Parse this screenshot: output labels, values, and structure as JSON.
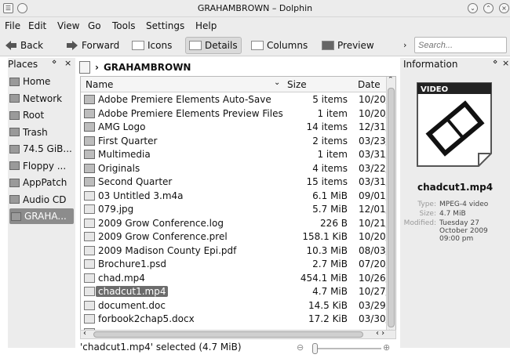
{
  "window": {
    "title": "GRAHAMBROWN – Dolphin"
  },
  "menu": [
    "File",
    "Edit",
    "View",
    "Go",
    "Tools",
    "Settings",
    "Help"
  ],
  "toolbar": {
    "back": "Back",
    "forward": "Forward",
    "icons": "Icons",
    "details": "Details",
    "columns": "Columns",
    "preview": "Preview"
  },
  "search": {
    "placeholder": "Search..."
  },
  "places": {
    "title": "Places",
    "items": [
      {
        "label": "Home",
        "icon": "home-icon"
      },
      {
        "label": "Network",
        "icon": "network-icon"
      },
      {
        "label": "Root",
        "icon": "folder-icon"
      },
      {
        "label": "Trash",
        "icon": "trash-icon"
      },
      {
        "label": "74.5 GiB...",
        "icon": "hard-drive-icon"
      },
      {
        "label": "Floppy ...",
        "icon": "floppy-icon"
      },
      {
        "label": "AppPatch",
        "icon": "folder-icon"
      },
      {
        "label": "Audio CD",
        "icon": "cd-icon"
      },
      {
        "label": "GRAHA...",
        "icon": "drive-icon",
        "selected": true
      }
    ]
  },
  "breadcrumb": {
    "current": "GRAHAMBROWN"
  },
  "columns": {
    "name": "Name",
    "size": "Size",
    "date": "Date"
  },
  "files": [
    {
      "name": "Adobe Premiere Elements Auto-Save",
      "size": "5 items",
      "date": "10/20/",
      "type": "folder"
    },
    {
      "name": "Adobe Premiere Elements Preview Files",
      "size": "1 item",
      "date": "10/20/",
      "type": "folder"
    },
    {
      "name": "AMG Logo",
      "size": "14 items",
      "date": "12/31/",
      "type": "folder"
    },
    {
      "name": "First Quarter",
      "size": "2 items",
      "date": "03/23/",
      "type": "folder"
    },
    {
      "name": "Multimedia",
      "size": "1 item",
      "date": "03/31/",
      "type": "folder"
    },
    {
      "name": "Originals",
      "size": "4 items",
      "date": "03/22/",
      "type": "folder"
    },
    {
      "name": "Second Quarter",
      "size": "15 items",
      "date": "03/31/",
      "type": "folder"
    },
    {
      "name": "03 Untitled 3.m4a",
      "size": "6.1 MiB",
      "date": "09/01/",
      "type": "file"
    },
    {
      "name": "079.jpg",
      "size": "5.7 MiB",
      "date": "12/01/",
      "type": "file"
    },
    {
      "name": "2009 Grow Conference.log",
      "size": "226 B",
      "date": "10/21/",
      "type": "file"
    },
    {
      "name": "2009 Grow Conference.prel",
      "size": "158.1 KiB",
      "date": "10/20/",
      "type": "file"
    },
    {
      "name": "2009 Madison County Epi.pdf",
      "size": "10.3 MiB",
      "date": "08/03/",
      "type": "file"
    },
    {
      "name": "Brochure1.psd",
      "size": "2.7 MiB",
      "date": "07/20/",
      "type": "file"
    },
    {
      "name": "chad.mp4",
      "size": "454.1 MiB",
      "date": "10/26/",
      "type": "file"
    },
    {
      "name": "chadcut1.mp4",
      "size": "4.7 MiB",
      "date": "10/27/",
      "type": "file",
      "selected": true
    },
    {
      "name": "document.doc",
      "size": "14.5 KiB",
      "date": "03/29/",
      "type": "file"
    },
    {
      "name": "forbook2chap5.docx",
      "size": "17.2 KiB",
      "date": "03/30/",
      "type": "file"
    },
    {
      "name": "",
      "size": "",
      "date": "",
      "type": "file"
    }
  ],
  "status": {
    "text": "'chadcut1.mp4' selected (4.7 MiB)"
  },
  "info": {
    "title": "Information",
    "badge": "VIDEO",
    "filename": "chadcut1.mp4",
    "type_label": "Type:",
    "type_value": "MPEG-4 video",
    "size_label": "Size:",
    "size_value": "4.7 MiB",
    "modified_label": "Modified:",
    "modified_value": [
      "Tuesday 27",
      "October 2009",
      "09:00 pm"
    ]
  }
}
